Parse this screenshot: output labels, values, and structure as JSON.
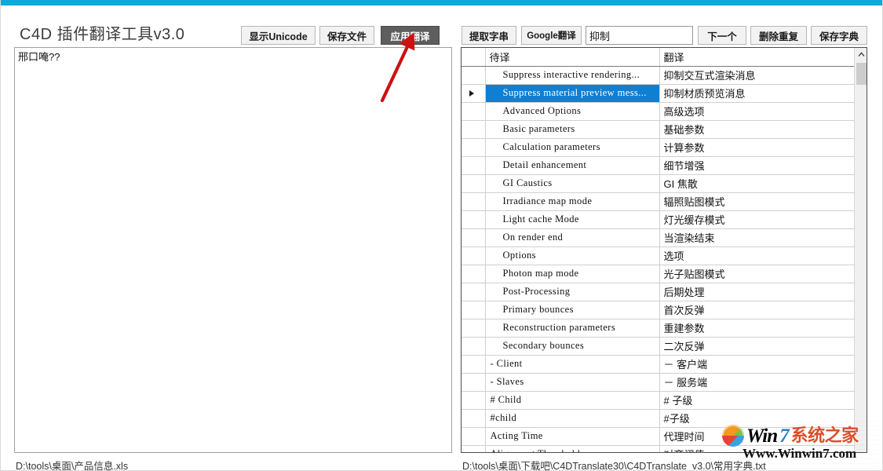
{
  "window": {
    "accent_color": "#0aabdc",
    "controls": [
      {
        "name": "minimize",
        "glyph": "–"
      },
      {
        "name": "maximize",
        "glyph": "☐"
      },
      {
        "name": "close",
        "glyph": "✕"
      }
    ]
  },
  "toolbar": {
    "app_title": "C4D 插件翻译工具v3.0",
    "show_unicode_label": "显示Unicode",
    "save_file_label": "保存文件",
    "apply_translation_label": "应用翻译",
    "extract_string_label": "提取字串",
    "google_translate_label": "Google翻译",
    "next_label": "下一个",
    "remove_duplicates_label": "删除重复",
    "save_dictionary_label": "保存字典",
    "search_value": "抑制",
    "search_placeholder": ""
  },
  "left_pane": {
    "content": "邢口唵??"
  },
  "grid": {
    "columns": [
      "",
      "待译",
      "翻译"
    ],
    "selected_index": 1,
    "rows": [
      {
        "indent": 1,
        "source": "Suppress interactive rendering...",
        "target": "抑制交互式渲染消息"
      },
      {
        "indent": 1,
        "source": "Suppress material preview mess...",
        "target": "抑制材质预览消息"
      },
      {
        "indent": 1,
        "source": "Advanced Options",
        "target": "高级选项"
      },
      {
        "indent": 1,
        "source": "Basic parameters",
        "target": "基础参数"
      },
      {
        "indent": 1,
        "source": "Calculation parameters",
        "target": "计算参数"
      },
      {
        "indent": 1,
        "source": "Detail enhancement",
        "target": "细节增强"
      },
      {
        "indent": 1,
        "source": "GI Caustics",
        "target": "GI 焦散"
      },
      {
        "indent": 1,
        "source": "Irradiance map mode",
        "target": "辐照贴图模式"
      },
      {
        "indent": 1,
        "source": "Light cache Mode",
        "target": "灯光缓存模式"
      },
      {
        "indent": 1,
        "source": "On render end",
        "target": "当渲染结束"
      },
      {
        "indent": 1,
        "source": "Options",
        "target": "选项"
      },
      {
        "indent": 1,
        "source": "Photon map mode",
        "target": "光子贴图模式"
      },
      {
        "indent": 1,
        "source": "Post-Processing",
        "target": "后期处理"
      },
      {
        "indent": 1,
        "source": "Primary bounces",
        "target": "首次反弹"
      },
      {
        "indent": 1,
        "source": "Reconstruction parameters",
        "target": "重建参数"
      },
      {
        "indent": 1,
        "source": "Secondary bounces",
        "target": "二次反弹"
      },
      {
        "indent": 0,
        "source": "- Client",
        "target": "－ 客户端"
      },
      {
        "indent": 0,
        "source": "- Slaves",
        "target": "－ 服务端"
      },
      {
        "indent": 0,
        "source": "# Child",
        "target": "# 子级"
      },
      {
        "indent": 0,
        "source": "#child",
        "target": "#子级"
      },
      {
        "indent": 0,
        "source": "Acting Time",
        "target": "代理时间"
      },
      {
        "indent": 0,
        "source": "Alignment Threshold",
        "target": "对齐阈值"
      }
    ]
  },
  "status": {
    "left_path": "D:\\tools\\桌面\\产品信息.xls",
    "right_path": "D:\\tools\\桌面\\下载吧\\C4DTranslate30\\C4DTranslate_v3.0\\常用字典.txt"
  },
  "annotation": {
    "arrow_color": "#cc1111"
  },
  "watermark": {
    "brand_win": "Win",
    "brand_seven": "7",
    "brand_cn": "系统之家",
    "url": "Www.Winwin7.com"
  }
}
